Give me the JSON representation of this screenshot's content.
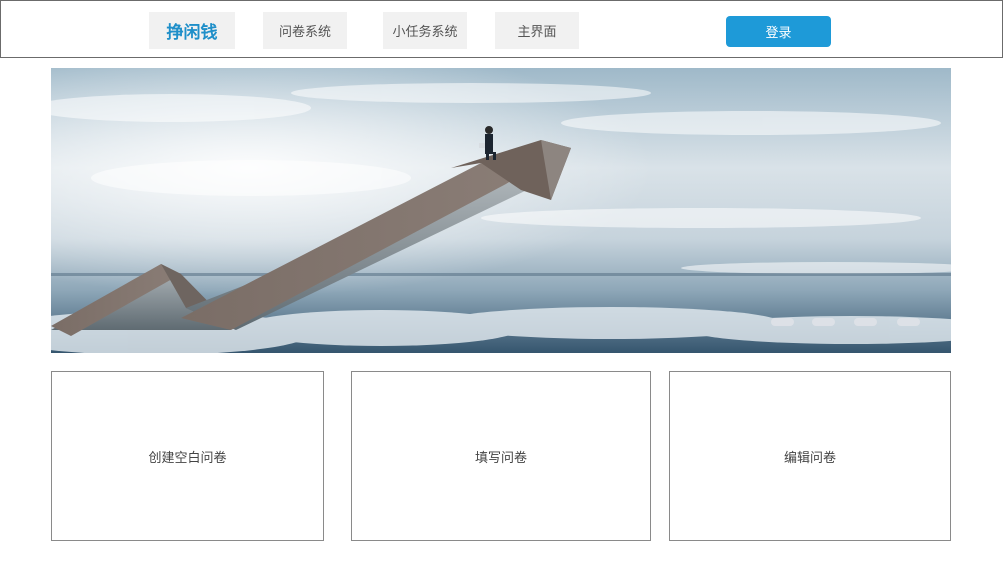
{
  "header": {
    "brand": "挣闲钱",
    "nav": [
      "问卷系统",
      "小任务系统",
      "主界面"
    ],
    "login_label": "登录",
    "brand_color": "#1f8fc9",
    "login_color": "#1e9ad8"
  },
  "banner": {
    "slide_count": 4,
    "image_subject": "businessman-on-rising-staircase-arrow-above-clouds"
  },
  "cards": [
    {
      "label": "创建空白问卷"
    },
    {
      "label": "填写问卷"
    },
    {
      "label": "编辑问卷"
    }
  ]
}
